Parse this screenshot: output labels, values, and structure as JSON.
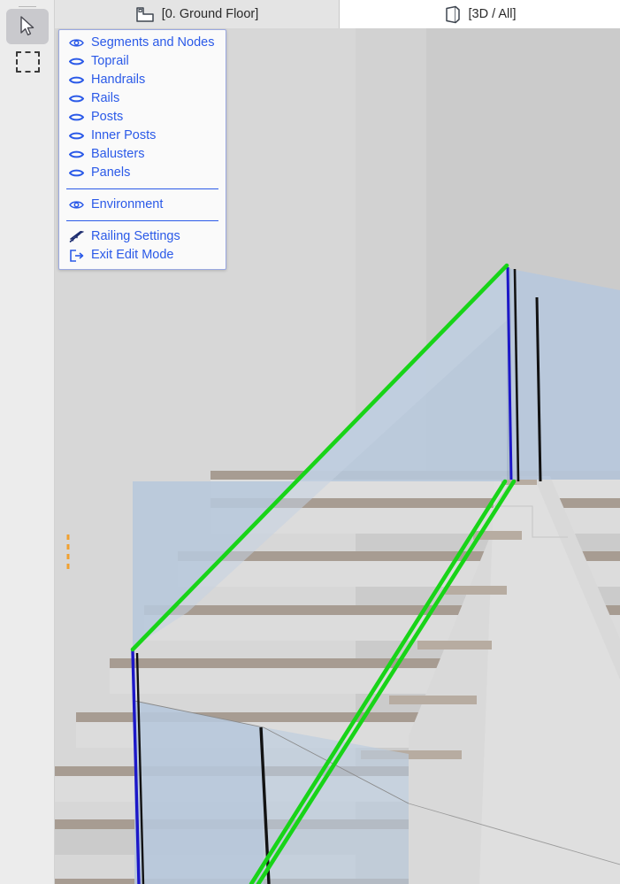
{
  "toolbar": {
    "tools": [
      {
        "name": "arrow-select-tool",
        "icon": "arrow-cursor-icon",
        "selected": true
      },
      {
        "name": "marquee-select-tool",
        "icon": "marquee-rectangle-icon",
        "selected": false
      }
    ]
  },
  "tabs": [
    {
      "id": "ground-floor",
      "label": "[0. Ground Floor]",
      "icon": "floor-plan-icon",
      "active": false
    },
    {
      "id": "3d-all",
      "label": "[3D / All]",
      "icon": "3d-box-icon",
      "active": true
    }
  ],
  "context_menu": {
    "groups": [
      {
        "items": [
          {
            "label": "Segments and Nodes",
            "icon": "eye-open-icon",
            "visible": true
          },
          {
            "label": "Toprail",
            "icon": "eye-closed-icon",
            "visible": false
          },
          {
            "label": "Handrails",
            "icon": "eye-closed-icon",
            "visible": false
          },
          {
            "label": "Rails",
            "icon": "eye-closed-icon",
            "visible": false
          },
          {
            "label": "Posts",
            "icon": "eye-closed-icon",
            "visible": false
          },
          {
            "label": "Inner Posts",
            "icon": "eye-closed-icon",
            "visible": false
          },
          {
            "label": "Balusters",
            "icon": "eye-closed-icon",
            "visible": false
          },
          {
            "label": "Panels",
            "icon": "eye-closed-icon",
            "visible": false
          }
        ]
      },
      {
        "items": [
          {
            "label": "Environment",
            "icon": "eye-open-icon",
            "visible": true
          }
        ]
      },
      {
        "items": [
          {
            "label": "Railing Settings",
            "icon": "railing-icon",
            "visible": false
          },
          {
            "label": "Exit Edit Mode",
            "icon": "exit-arrow-icon",
            "visible": false
          }
        ]
      }
    ]
  },
  "viewport": {
    "scene": "stair-with-glass-railing",
    "colors": {
      "background": "#d4d4d4",
      "glass_panel": "#b7c8dc",
      "glass_panel_light": "#c2d1e1",
      "stair_riser": "#dcdcdc",
      "stair_tread": "#a79c92",
      "selection_green": "#18d418",
      "post_highlight_blue": "#1c17c8",
      "post_black": "#101010",
      "marker_orange": "#f0a030",
      "wall_shade": "#cfcfcf"
    },
    "annotations": {
      "selected_segment": "toprail-segment-highlighted-green",
      "edited_node": "post-node-highlighted-blue",
      "snap_marker": "orange-dashed-guide"
    }
  }
}
